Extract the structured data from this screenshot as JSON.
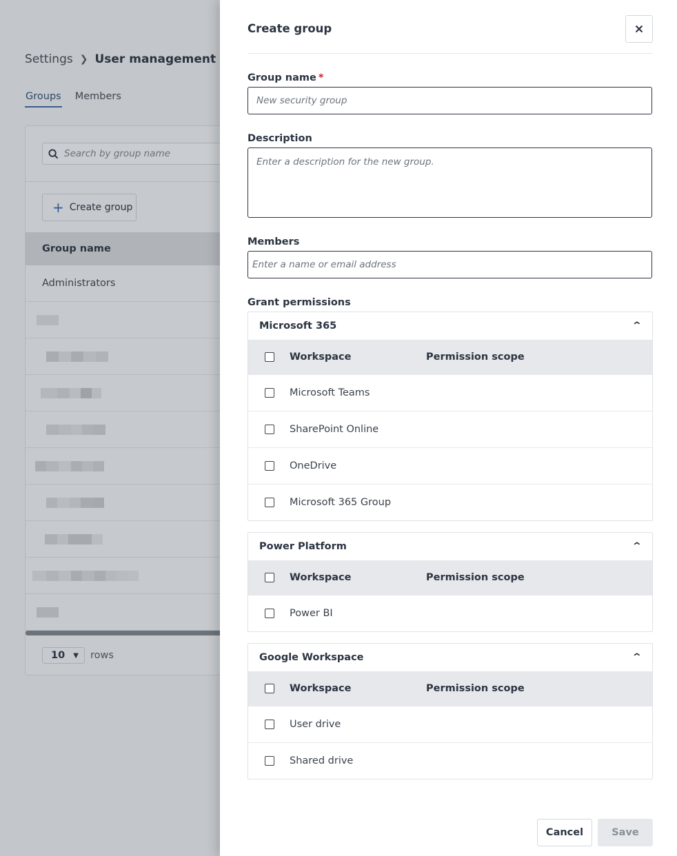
{
  "breadcrumb": {
    "parent": "Settings",
    "current": "User management"
  },
  "tabs": [
    {
      "label": "Groups",
      "active": true
    },
    {
      "label": "Members",
      "active": false
    }
  ],
  "search": {
    "placeholder": "Search by group name"
  },
  "create_group_button": "Create group",
  "table": {
    "column_header": "Group name",
    "rows": [
      "Administrators"
    ]
  },
  "pagination": {
    "rows_value": "10",
    "rows_label": "rows"
  },
  "drawer": {
    "title": "Create group",
    "close_icon": "close-icon",
    "group_name": {
      "label": "Group name",
      "required_mark": "*",
      "placeholder": "New security group"
    },
    "description": {
      "label": "Description",
      "placeholder": "Enter a description for the new group."
    },
    "members": {
      "label": "Members",
      "placeholder": "Enter a name or email address"
    },
    "grant_permissions_label": "Grant permissions",
    "sections": [
      {
        "title": "Microsoft 365",
        "col_workspace": "Workspace",
        "col_scope": "Permission scope",
        "items": [
          "Microsoft Teams",
          "SharePoint Online",
          "OneDrive",
          "Microsoft 365 Group"
        ]
      },
      {
        "title": "Power Platform",
        "col_workspace": "Workspace",
        "col_scope": "Permission scope",
        "items": [
          "Power BI"
        ]
      },
      {
        "title": "Google Workspace",
        "col_workspace": "Workspace",
        "col_scope": "Permission scope",
        "items": [
          "User drive",
          "Shared drive"
        ]
      }
    ],
    "cancel_label": "Cancel",
    "save_label": "Save"
  },
  "colors": {
    "accent": "#2e5c94",
    "required": "#c62828",
    "overlay": "#c3c6ca"
  }
}
